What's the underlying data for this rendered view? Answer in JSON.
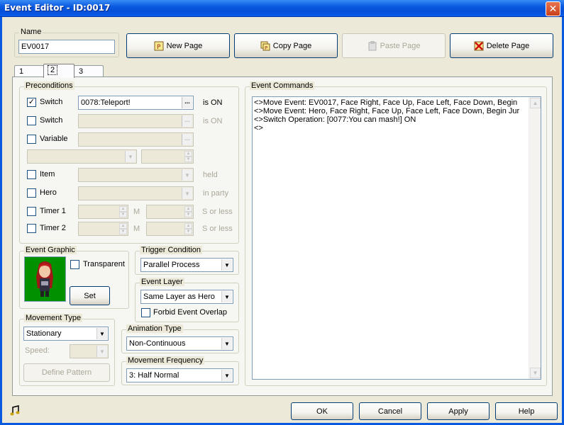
{
  "window": {
    "title": "Event Editor - ID:0017",
    "close_label": "✕"
  },
  "name": {
    "label": "Name",
    "value": "EV0017"
  },
  "page_buttons": {
    "new_page": "New Page",
    "copy_page": "Copy Page",
    "paste_page": "Paste Page",
    "delete_page": "Delete Page"
  },
  "tabs": [
    {
      "label": "1",
      "active": false
    },
    {
      "label": "2",
      "active": true
    },
    {
      "label": "3",
      "active": false
    }
  ],
  "preconditions": {
    "label": "Preconditions",
    "switch1": {
      "checked": true,
      "label": "Switch",
      "value": "0078:Teleport!",
      "suffix": "is ON",
      "button": "..."
    },
    "switch2": {
      "checked": false,
      "label": "Switch",
      "value": "",
      "suffix": "is ON",
      "button": "..."
    },
    "variable": {
      "checked": false,
      "label": "Variable",
      "value": "",
      "button": "..."
    },
    "item": {
      "checked": false,
      "label": "Item",
      "suffix": "held"
    },
    "hero": {
      "checked": false,
      "label": "Hero",
      "suffix": "in party"
    },
    "timer1": {
      "checked": false,
      "label": "Timer 1",
      "m": "M",
      "suffix": "S or less"
    },
    "timer2": {
      "checked": false,
      "label": "Timer 2",
      "m": "M",
      "suffix": "S or less"
    }
  },
  "event_graphic": {
    "label": "Event Graphic",
    "transparent_label": "Transparent",
    "transparent_checked": false,
    "set_label": "Set"
  },
  "trigger_condition": {
    "label": "Trigger Condition",
    "value": "Parallel Process"
  },
  "event_layer": {
    "label": "Event Layer",
    "value": "Same Layer as Hero",
    "forbid_label": "Forbid Event Overlap",
    "forbid_checked": false
  },
  "movement_type": {
    "label": "Movement Type",
    "value": "Stationary",
    "speed_label": "Speed:",
    "define_pattern": "Define Pattern"
  },
  "animation_type": {
    "label": "Animation Type",
    "value": "Non-Continuous"
  },
  "movement_frequency": {
    "label": "Movement Frequency",
    "value": "3: Half Normal"
  },
  "event_commands": {
    "label": "Event Commands",
    "lines": [
      "<>Move Event: EV0017, Face Right, Face Up, Face Left, Face Down, Begin",
      "<>Move Event: Hero, Face Right, Face Up, Face Left, Face Down, Begin Jur",
      "<>Switch Operation: [0077:You can mash!] ON",
      "<>"
    ]
  },
  "footer": {
    "ok": "OK",
    "cancel": "Cancel",
    "apply": "Apply",
    "help": "Help"
  },
  "icons": {
    "new_page": "page-p-icon",
    "copy_page": "copy-page-icon",
    "paste_page": "paste-page-icon",
    "delete_page": "delete-page-icon",
    "music": "music-note-icon"
  },
  "colors": {
    "title_bar": "#0a5ae0",
    "sprite_bg": "#009000"
  }
}
